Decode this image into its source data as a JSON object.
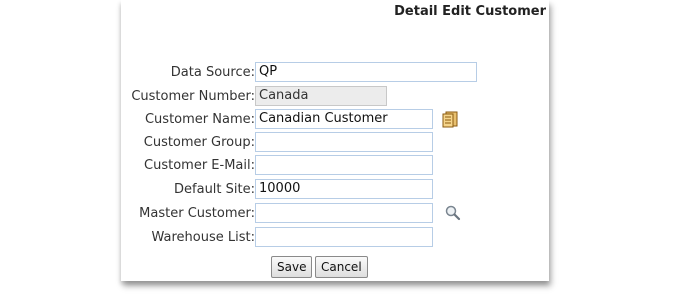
{
  "header": {
    "title": "Detail Edit Customer"
  },
  "form": {
    "data_source": {
      "label": "Data Source:",
      "value": "QP"
    },
    "customer_number": {
      "label": "Customer Number:",
      "value": "Canada"
    },
    "customer_name": {
      "label": "Customer Name:",
      "value": "Canadian Customer",
      "action_icon": "notebook-icon"
    },
    "customer_group": {
      "label": "Customer Group:",
      "value": ""
    },
    "customer_email": {
      "label": "Customer E-Mail:",
      "value": ""
    },
    "default_site": {
      "label": "Default Site:",
      "value": "10000"
    },
    "master_customer": {
      "label": "Master Customer:",
      "value": "",
      "action_icon": "magnifier-search-icon"
    },
    "warehouse_list": {
      "label": "Warehouse List:",
      "value": ""
    }
  },
  "buttons": {
    "save_label": "Save",
    "cancel_label": "Cancel"
  },
  "colors": {
    "field_border": "#b7cde6",
    "readonly_bg": "#ececec"
  }
}
